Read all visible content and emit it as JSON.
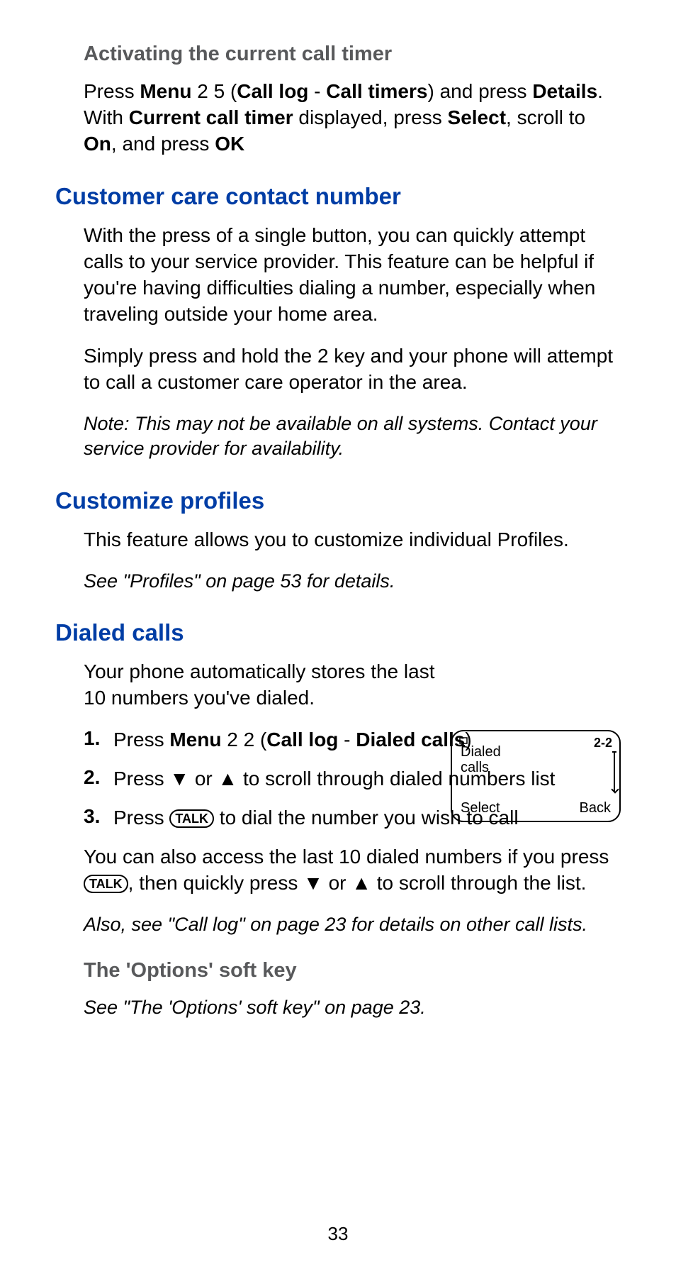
{
  "section1": {
    "heading": "Activating the current call timer",
    "p1_a": "Press ",
    "p1_menu": "Menu",
    "p1_b": " 2 5 (",
    "p1_calllog": "Call log",
    "p1_c": " - ",
    "p1_calltimers": "Call timers",
    "p1_d": ") and press ",
    "p1_details": "Details",
    "p1_e": ". With ",
    "p1_cct": "Current call timer",
    "p1_f": " displayed, press ",
    "p1_select": "Select",
    "p1_g": ", scroll to ",
    "p1_on": "On",
    "p1_h": ", and press ",
    "p1_ok": "OK"
  },
  "section2": {
    "heading": "Customer care contact number",
    "p1": "With the press of a single button, you can quickly attempt calls to your service provider. This feature can be helpful if you're having difficulties dialing a number, especially when traveling outside your home area.",
    "p2": "Simply press and hold the 2 key and your phone will attempt to call a customer care operator in the area.",
    "note": "Note: This may not be available on all systems. Contact your service provider for availability."
  },
  "section3": {
    "heading": "Customize profiles",
    "p1": "This feature allows you to customize individual Profiles.",
    "note": " See \"Profiles\" on page 53 for details."
  },
  "section4": {
    "heading": "Dialed calls",
    "p1": "Your phone automatically stores the last 10 numbers you've dialed.",
    "step1_a": "Press ",
    "step1_menu": "Menu",
    "step1_b": " 2 2 (",
    "step1_calllog": "Call log",
    "step1_c": " - ",
    "step1_dialed": "Dialed calls",
    "step1_d": ")",
    "step2_a": "Press ▼ or ▲ to scroll through dialed numbers list",
    "step3_a": "Press ",
    "step3_talk": "TALK",
    "step3_b": " to dial the number you wish to call",
    "p2_a": "You can also access the last 10 dialed numbers if you press ",
    "p2_talk": "TALK",
    "p2_b": ", then quickly press ▼ or ▲ to scroll through the list.",
    "note": "Also, see \"Call log\" on page 23 for details on other call lists."
  },
  "section5": {
    "heading": "The 'Options' soft key",
    "note": "See \"The 'Options' soft key\" on page 23."
  },
  "phone": {
    "menu_index": "2-2",
    "title": "Dialed",
    "subtitle": "calls",
    "left_soft": "Select",
    "right_soft": "Back"
  },
  "page_number": "33",
  "list_numbers": {
    "n1": "1.",
    "n2": "2.",
    "n3": "3."
  }
}
